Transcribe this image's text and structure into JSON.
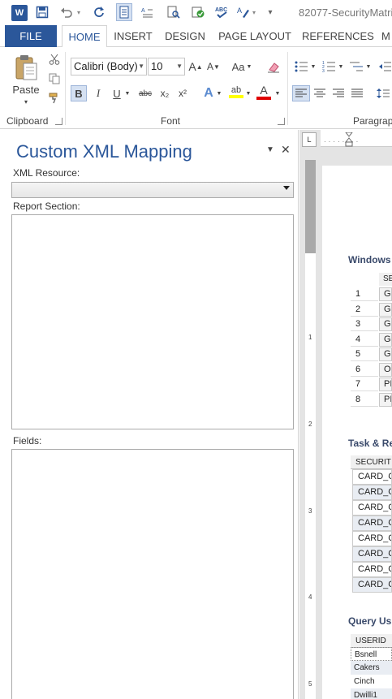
{
  "title_bar": {
    "app_logo": "W",
    "doc_title": "82077-SecurityMatri",
    "qat_icons": [
      "save-icon",
      "undo-icon",
      "redo-icon",
      "document-icon",
      "spelling-icon",
      "print-preview-icon",
      "approve-icon",
      "abc-check-icon",
      "format-painter-icon",
      "customize-icon"
    ]
  },
  "tabs": [
    "FILE",
    "HOME",
    "INSERT",
    "DESIGN",
    "PAGE LAYOUT",
    "REFERENCES",
    "M"
  ],
  "ribbon": {
    "clipboard": {
      "paste_label": "Paste",
      "group_label": "Clipboard"
    },
    "font": {
      "font_name": "Calibri (Body)",
      "font_size": "10",
      "grow_label": "A",
      "shrink_label": "A",
      "change_case_label": "Aa",
      "bold": "B",
      "italic": "I",
      "underline": "U",
      "strikethrough": "abc",
      "subscript": "x₂",
      "superscript": "x²",
      "text_effects": "A",
      "highlight": "ab",
      "font_color": "A",
      "group_label": "Font"
    },
    "paragraph": {
      "group_label": "Paragrap"
    },
    "colors": {
      "accent": "#2b579a",
      "highlight_yellow": "#ffff00",
      "font_red": "#e00000",
      "selected_bg": "#d5e1f2"
    }
  },
  "task_pane": {
    "title": "Custom XML Mapping",
    "xml_resource_label": "XML Resource:",
    "xml_resource_value": "",
    "report_section_label": "Report Section:",
    "fields_label": "Fields:"
  },
  "ruler": {
    "corner": "L",
    "vertical_numbers": [
      "1",
      "2",
      "3",
      "4",
      "5"
    ]
  },
  "document": {
    "heading1": "Windows",
    "table1_header": "SE",
    "table1_rows": [
      {
        "num": "1",
        "val": "G"
      },
      {
        "num": "2",
        "val": "G"
      },
      {
        "num": "3",
        "val": "G"
      },
      {
        "num": "4",
        "val": "G"
      },
      {
        "num": "5",
        "val": "G"
      },
      {
        "num": "6",
        "val": "O"
      },
      {
        "num": "7",
        "val": "PI"
      },
      {
        "num": "8",
        "val": "PI"
      }
    ],
    "heading2": "Task & Re",
    "table2_header": "SECURIT",
    "table2_rows": [
      "CARD_C",
      "CARD_C",
      "CARD_C",
      "CARD_C",
      "CARD_C",
      "CARD_C",
      "CARD_C",
      "CARD_C"
    ],
    "heading3": "Query Us",
    "table3_header": "USERID",
    "table3_rows": [
      "Bsnell",
      "Cakers",
      "Cinch",
      "Dwilli1"
    ]
  }
}
